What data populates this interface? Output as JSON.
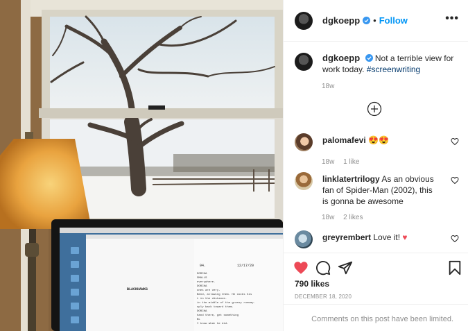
{
  "post": {
    "username": "dgkoepp",
    "follow_label": "Follow",
    "more_label": "•••",
    "caption_text": "Not a terrible view for work today.",
    "caption_hashtag": "#screenwriting",
    "caption_time": "18w",
    "likes": "790 likes",
    "date": "DECEMBER 18, 2020",
    "comments_limited": "Comments on this post have been limited."
  },
  "comments": [
    {
      "username": "palomafevi",
      "text": "",
      "time": "18w",
      "likes": "1 like",
      "reply": ""
    },
    {
      "username": "linklatertrilogy",
      "text": "As an obvious fan of Spider-Man (2002), this is gonna be awesome",
      "time": "18w",
      "likes": "2 likes",
      "reply": ""
    },
    {
      "username": "greyrembert",
      "text": "Love it!",
      "time": "",
      "likes": "",
      "reply": ""
    }
  ],
  "script_page": {
    "title": "BLACKHAWKS",
    "page_number": "94.",
    "date": "12/17/20",
    "lines": [
      "DORCHA",
      "SMALLS",
      "everywhere.",
      "DORCHA",
      "ones are very-",
      "Bend, allowing them. He cocks his",
      "t in the distance.",
      "in the middle of the grassy runway.",
      "oply back toward them.",
      "DORCHA",
      "hand there, get something",
      "BL",
      "I know what he did."
    ]
  },
  "colors": {
    "accent": "#0095f6",
    "like_red": "#ed4956",
    "hashtag": "#00376b"
  },
  "icons": [
    "verified-badge-icon",
    "more-options-icon",
    "plus-circle-icon",
    "heart-icon",
    "comment-icon",
    "share-icon",
    "bookmark-icon"
  ]
}
